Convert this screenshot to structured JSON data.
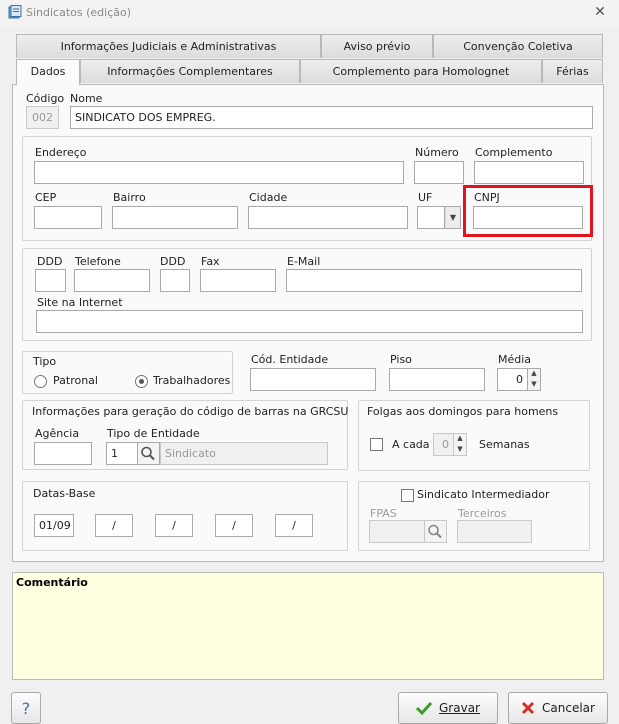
{
  "window": {
    "title": "Sindicatos (edição)"
  },
  "tabs_row1": [
    "Informações Judiciais e Administrativas",
    "Aviso prévio",
    "Convenção Coletiva"
  ],
  "tabs_row2": [
    "Dados",
    "Informações Complementares",
    "Complemento para Homolognet",
    "Férias"
  ],
  "form": {
    "codigo_label": "Código",
    "codigo_value": "002",
    "nome_label": "Nome",
    "nome_value": "SINDICATO DOS EMPREG.",
    "endereco_label": "Endereço",
    "numero_label": "Número",
    "complemento_label": "Complemento",
    "cep_label": "CEP",
    "bairro_label": "Bairro",
    "cidade_label": "Cidade",
    "uf_label": "UF",
    "cnpj_label": "CNPJ",
    "ddd_label": "DDD",
    "telefone_label": "Telefone",
    "ddd2_label": "DDD",
    "fax_label": "Fax",
    "email_label": "E-Mail",
    "site_label": "Site na Internet",
    "tipo_label": "Tipo",
    "patronal_label": "Patronal",
    "trabalhadores_label": "Trabalhadores",
    "cod_entidade_label": "Cód. Entidade",
    "piso_label": "Piso",
    "media_label": "Média",
    "media_value": "0",
    "grcsu_title": "Informações para geração do código de barras na GRCSU",
    "agencia_label": "Agência",
    "tipo_entidade_label": "Tipo de Entidade",
    "tipo_entidade_value": "1",
    "tipo_entidade_desc": "Sindicato",
    "folgas_title": "Folgas aos domingos para homens",
    "a_cada_label": "A cada",
    "a_cada_value": "0",
    "semanas_label": "Semanas",
    "datas_base_title": "Datas-Base",
    "datas_base": [
      "01/09",
      "/",
      "/",
      "/",
      "/"
    ],
    "intermediador_label": "Sindicato Intermediador",
    "fpas_label": "FPAS",
    "terceiros_label": "Terceiros"
  },
  "comment": {
    "label": "Comentário"
  },
  "buttons": {
    "help": "?",
    "save": "Gravar",
    "cancel": "Cancelar"
  },
  "colors": {
    "highlight": "#e0141e",
    "comment_bg": "#ffffe1"
  }
}
